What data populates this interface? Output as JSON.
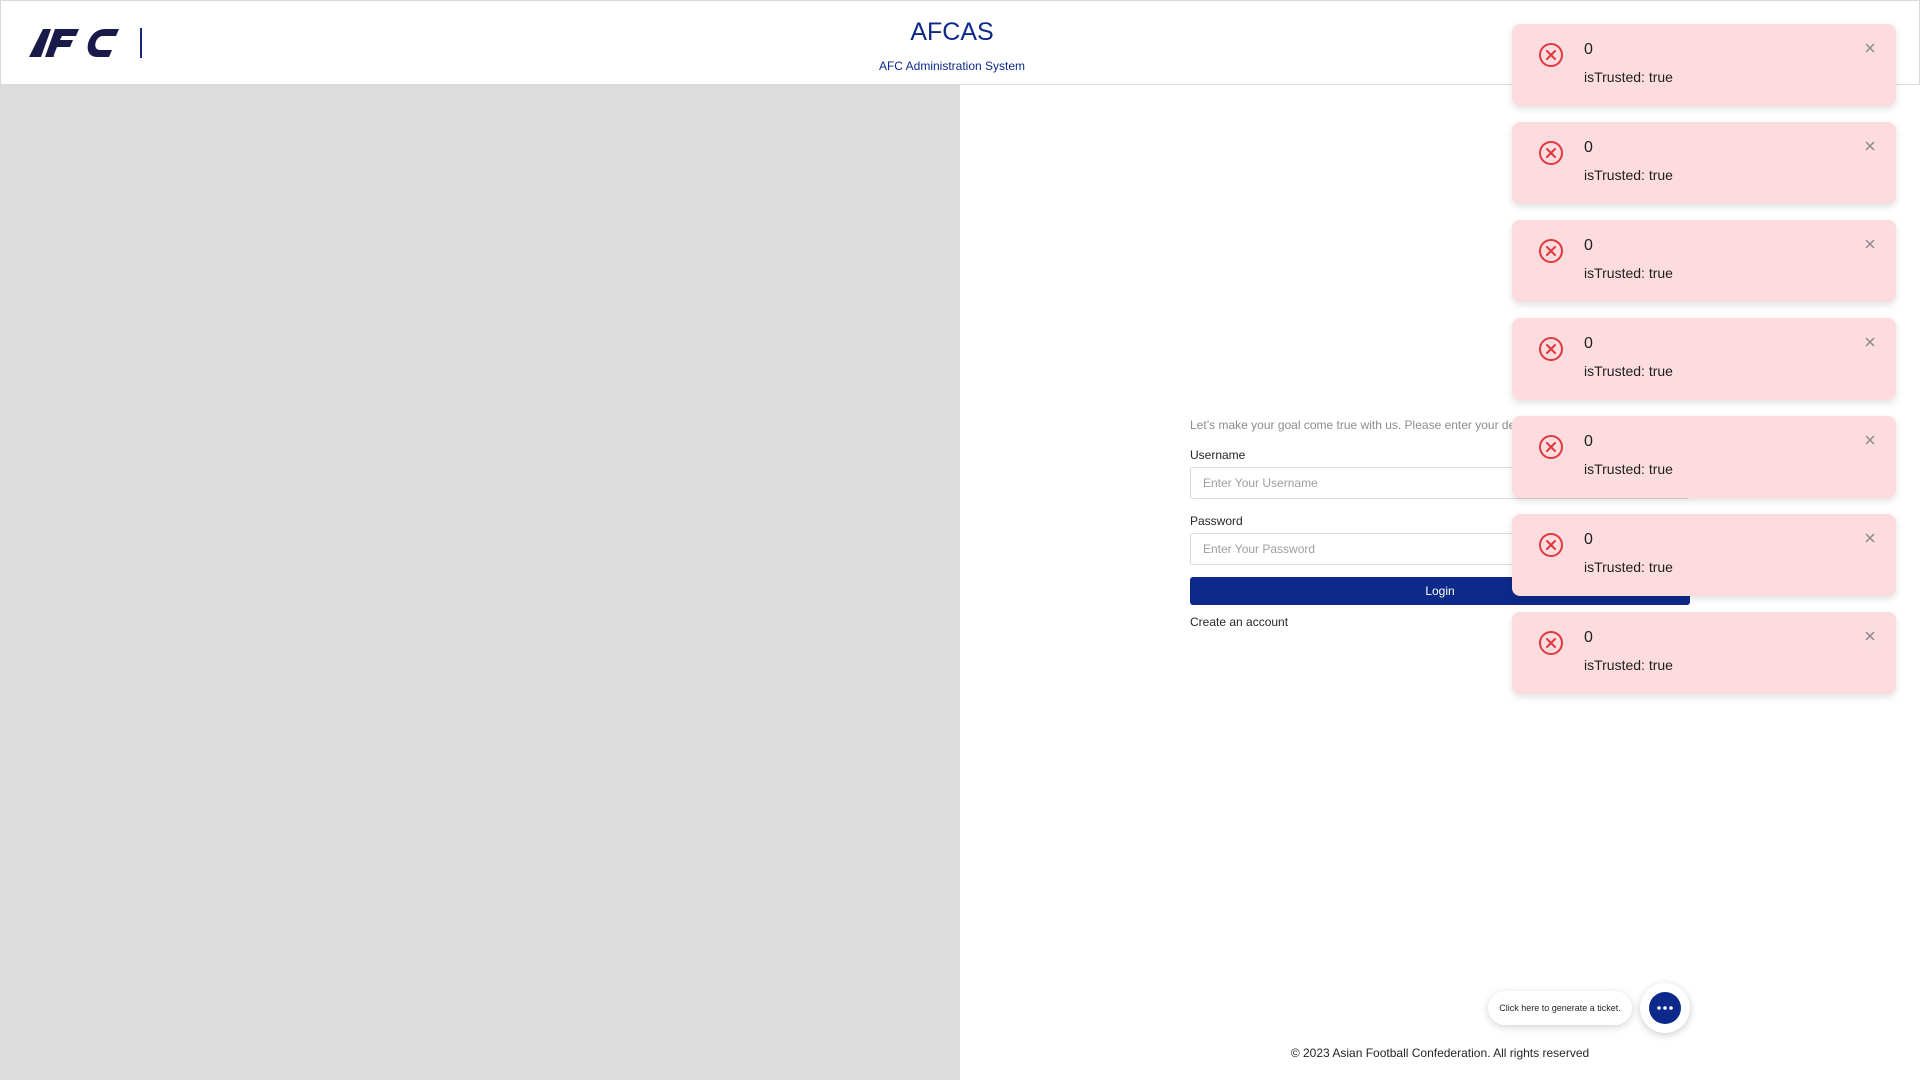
{
  "header": {
    "logo_text": "AFC",
    "title": "AFCAS",
    "subtitle": "AFC Administration System"
  },
  "form": {
    "intro": "Let’s make your goal come true with us. Please enter your det",
    "username_label": "Username",
    "username_placeholder": "Enter Your Username",
    "password_label": "Password",
    "password_placeholder": "Enter Your Password",
    "login_label": "Login",
    "create_account": "Create an account"
  },
  "toasts": [
    {
      "title": "0",
      "message": "isTrusted: true"
    },
    {
      "title": "0",
      "message": "isTrusted: true"
    },
    {
      "title": "0",
      "message": "isTrusted: true"
    },
    {
      "title": "0",
      "message": "isTrusted: true"
    },
    {
      "title": "0",
      "message": "isTrusted: true"
    },
    {
      "title": "0",
      "message": "isTrusted: true"
    },
    {
      "title": "0",
      "message": "isTrusted: true"
    }
  ],
  "ticket": {
    "tooltip": "Click here to generate a ticket.",
    "icon": "chat-bubble-icon"
  },
  "footer": {
    "copyright": "© 2023 Asian Football Confederation. All rights reserved"
  },
  "colors": {
    "brand": "#0d2a8a",
    "toast_bg": "#fcdcde",
    "error_icon": "#e0393e",
    "left_panel": "#dcdcdc"
  }
}
